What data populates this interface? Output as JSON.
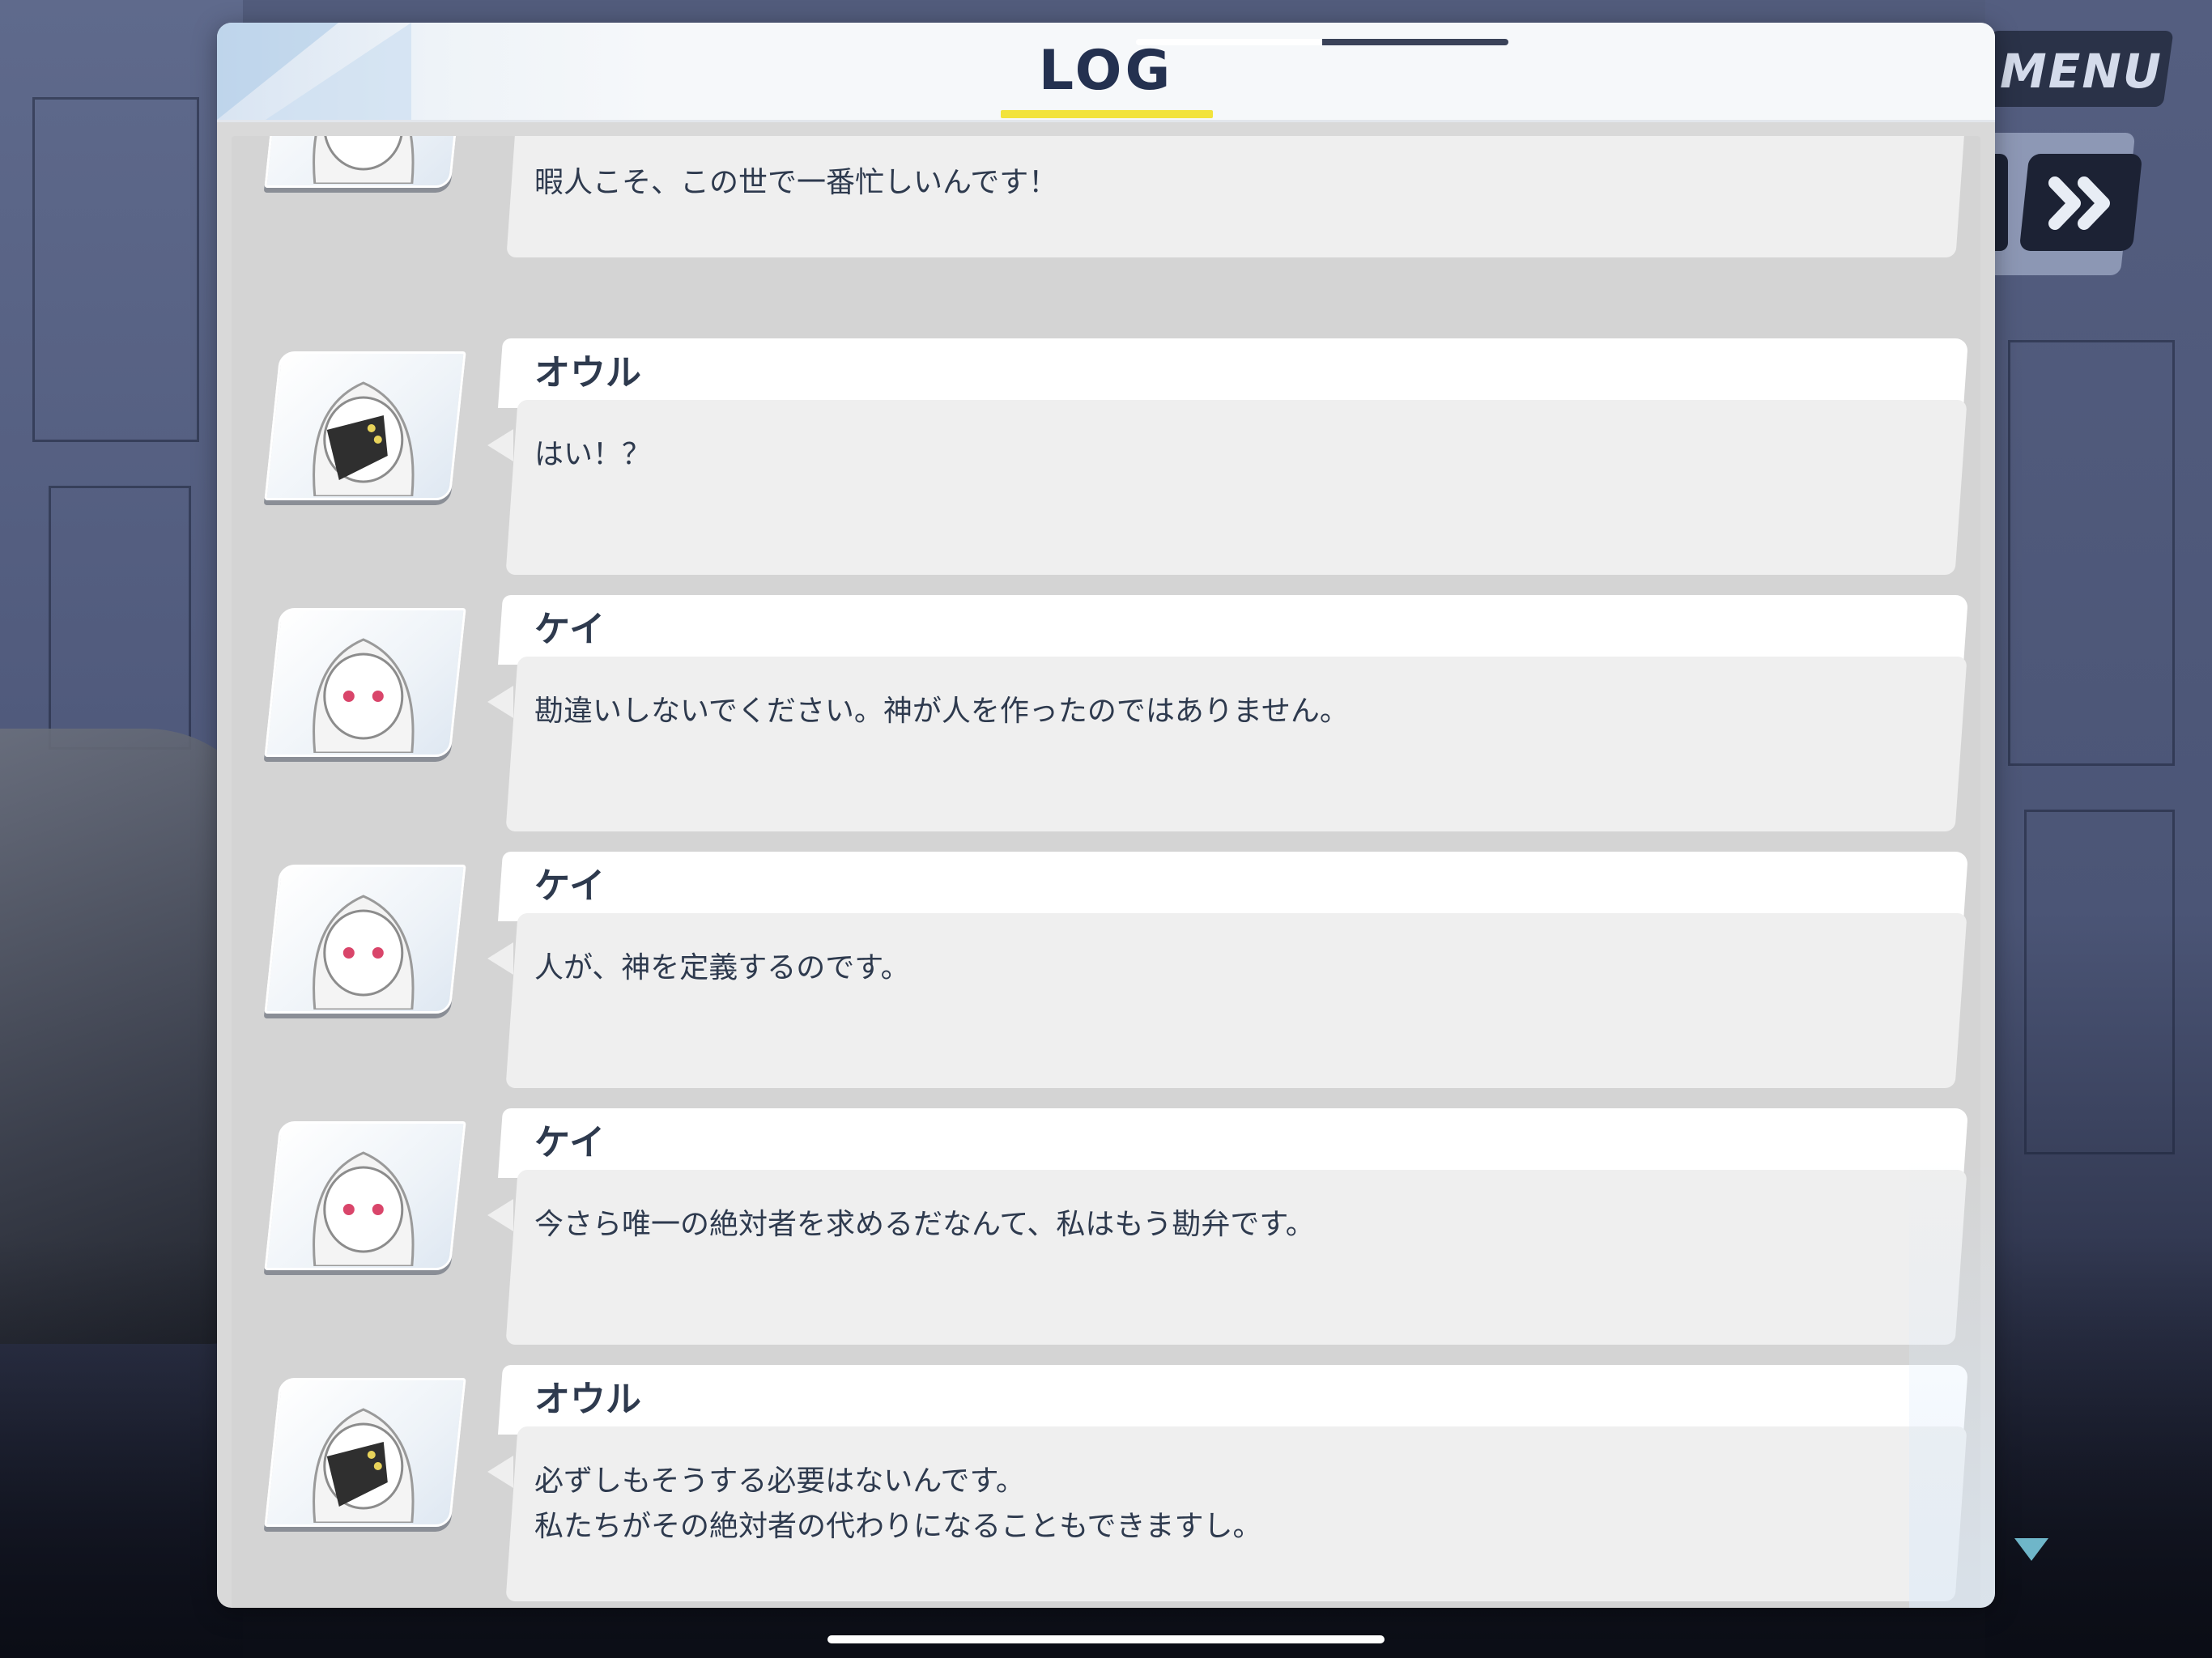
{
  "header": {
    "title": "LOG",
    "close_icon": "close-x-icon",
    "menu_label": "MENU",
    "fast_forward_icon": "fast-forward-icon"
  },
  "colors": {
    "title_text": "#243150",
    "title_underline": "#f2e33c",
    "message_text": "#2e3a4e",
    "name_bar": "#ffffff",
    "message_bubble": "#efefef",
    "menu_button": "#2a3248"
  },
  "log": {
    "entries": [
      {
        "speaker": "",
        "avatar": "kei-portrait",
        "text": "暇人こそ、この世で一番忙しいんです！"
      },
      {
        "speaker": "オウル",
        "avatar": "owl-portrait",
        "text": "はい！？"
      },
      {
        "speaker": "ケイ",
        "avatar": "kei-portrait",
        "text": "勘違いしないでください。神が人を作ったのではありません。"
      },
      {
        "speaker": "ケイ",
        "avatar": "kei-portrait",
        "text": "人が、神を定義するのです。"
      },
      {
        "speaker": "ケイ",
        "avatar": "kei-portrait",
        "text": "今さら唯一の絶対者を求めるだなんて、私はもう勘弁です。"
      },
      {
        "speaker": "オウル",
        "avatar": "owl-portrait",
        "text": "必ずしもそうする必要はないんです。\n私たちがその絶対者の代わりになることもできますし。"
      }
    ]
  }
}
